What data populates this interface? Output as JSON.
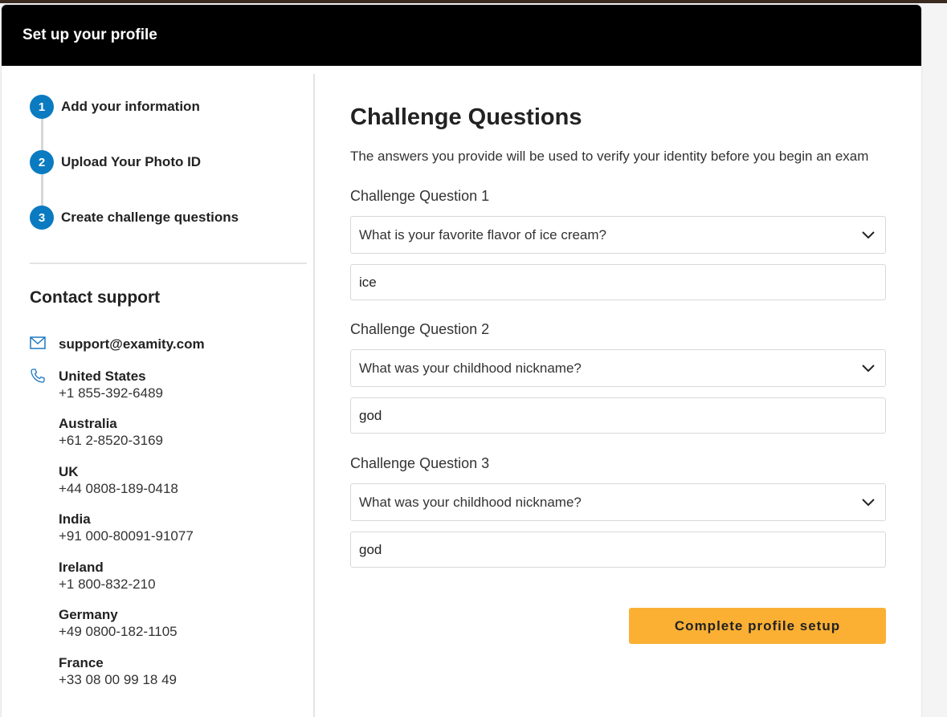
{
  "header": {
    "title": "Set up your profile"
  },
  "steps": [
    {
      "number": "1",
      "label": "Add your information"
    },
    {
      "number": "2",
      "label": "Upload Your Photo ID"
    },
    {
      "number": "3",
      "label": "Create challenge questions"
    }
  ],
  "contact": {
    "title": "Contact support",
    "email": "support@examity.com",
    "phones": [
      {
        "country": "United States",
        "number": "+1 855-392-6489"
      },
      {
        "country": "Australia",
        "number": "+61 2-8520-3169"
      },
      {
        "country": "UK",
        "number": "+44 0808-189-0418"
      },
      {
        "country": "India",
        "number": "+91 000-80091-91077"
      },
      {
        "country": "Ireland",
        "number": "+1 800-832-210"
      },
      {
        "country": "Germany",
        "number": "+49 0800-182-1105"
      },
      {
        "country": "France",
        "number": "+33 08 00 99 18 49"
      }
    ]
  },
  "main": {
    "title": "Challenge Questions",
    "subtitle": "The answers you provide will be used to verify your identity before you begin an exam",
    "questions": [
      {
        "label": "Challenge Question 1",
        "question": "What is your favorite flavor of ice cream?",
        "answer": "ice"
      },
      {
        "label": "Challenge Question 2",
        "question": "What was your childhood nickname?",
        "answer": "god"
      },
      {
        "label": "Challenge Question 3",
        "question": "What was your childhood nickname?",
        "answer": "god"
      }
    ],
    "submit_label": "Complete profile setup"
  },
  "colors": {
    "step_accent": "#0a7bc1",
    "button": "#fbb034",
    "header_bg": "#000000"
  },
  "icons": {
    "email": "mail-icon",
    "phone": "phone-icon",
    "select": "chevron-down-icon"
  }
}
